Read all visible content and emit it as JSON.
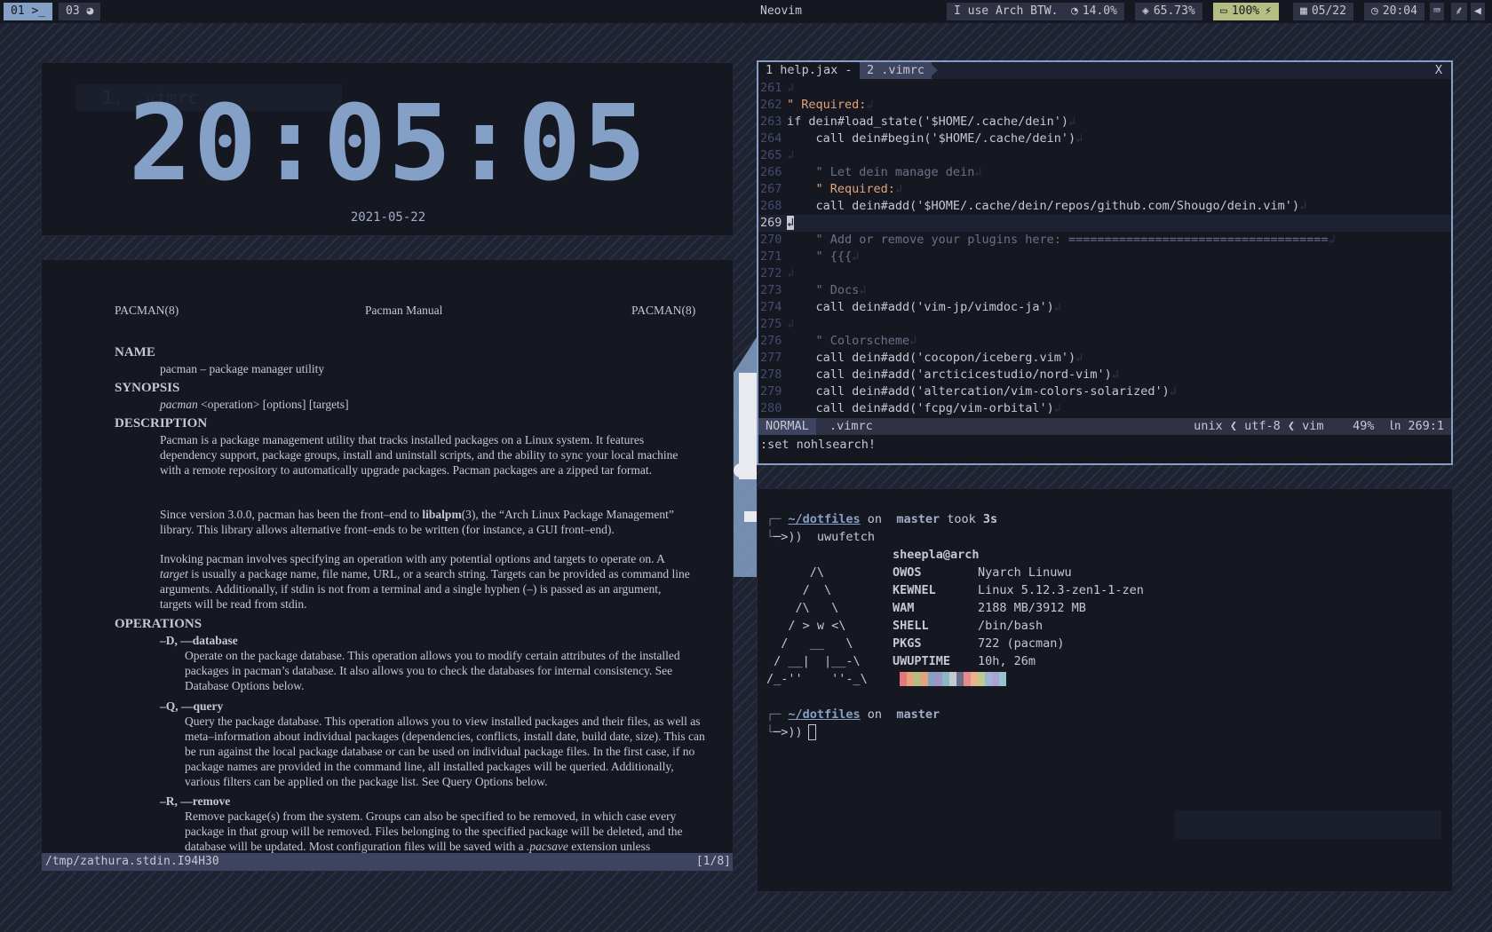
{
  "topbar": {
    "ws1": "01 >_",
    "ws3": "03 ◕",
    "title": "Neovim",
    "arch": "I use Arch BTW.",
    "cpu": "14.0%",
    "mem": "65.73%",
    "battery": "100%",
    "date": "05/22",
    "time": "20:04"
  },
  "clock": {
    "ghost": "1. .vimrc",
    "time": "20:05:05",
    "date": "2021-05-22"
  },
  "zathura": {
    "head_left": "PACMAN(8)",
    "head_center": "Pacman Manual",
    "head_right": "PACMAN(8)",
    "name_h": "NAME",
    "name_text": "pacman – package manager utility",
    "synopsis_h": "SYNOPSIS",
    "synopsis_cmd": "pacman",
    "synopsis_text": " <operation> [options] [targets]",
    "desc_h": "DESCRIPTION",
    "desc_p1": "Pacman is a package management utility that tracks installed packages on a Linux system. It features dependency support, package groups, install and uninstall scripts, and the ability to sync your local machine with a remote repository to automatically upgrade packages. Pacman packages are a zipped tar format.",
    "desc_p2a": "Since version 3.0.0, pacman has been the front–end to ",
    "desc_p2b": "libalpm",
    "desc_p2c": "(3), the “Arch Linux Package Management” library. This library allows alternative front–ends to be written (for instance, a GUI front–end).",
    "desc_p3a": "Invoking pacman involves specifying an operation with any potential options and targets to operate on. A ",
    "desc_p3b": "target",
    "desc_p3c": " is usually a package name, file name, URL, or a search string. Targets can be provided as command line arguments. Additionally, if stdin is not from a terminal and a single hyphen (–) is passed as an argument, targets will be read from stdin.",
    "ops_h": "OPERATIONS",
    "op_d": "–D, ––database",
    "op_d_text": "Operate on the package database. This operation allows you to modify certain attributes of the installed packages in pacman’s database. It also allows you to check the databases for internal consistency. See Database Options below.",
    "op_q": "–Q, ––query",
    "op_q_text": "Query the package database. This operation allows you to view installed packages and their files, as well as meta–information about individual packages (dependencies, conflicts, install date, build date, size). This can be run against the local package database or can be used on individual package files. In the first case, if no package names are provided in the command line, all installed packages will be queried. Additionally, various filters can be applied on the package list. See Query Options below.",
    "op_r": "–R, ––remove",
    "op_r_text_a": "Remove package(s) from the system. Groups can also be specified to be removed, in which case every package in that group will be removed. Files belonging to the specified package will be deleted, and the database will be updated. Most configuration files will be saved with a ",
    "op_r_text_b": ".pacsave",
    "op_r_text_c": " extension unless",
    "status_file": "/tmp/zathura.stdin.I94H30",
    "status_pages": "[1/8]"
  },
  "nvim": {
    "tab1": "1 help.jax -",
    "tab2": "2 .vimrc",
    "close": "X",
    "mode": "NORMAL",
    "file": ".vimrc",
    "ff": "unix",
    "enc": "utf-8",
    "ft": "vim",
    "pct": "49%",
    "ln_sym": "㏑",
    "pos": "269:1",
    "cmd": ":set nohlsearch!",
    "lines": [
      {
        "n": "261",
        "t": ""
      },
      {
        "n": "262",
        "t": "\" Required:"
      },
      {
        "n": "263",
        "t": "if dein#load_state('$HOME/.cache/dein')"
      },
      {
        "n": "264",
        "t": "    call dein#begin('$HOME/.cache/dein')"
      },
      {
        "n": "265",
        "t": ""
      },
      {
        "n": "266",
        "t": "    \" Let dein manage dein"
      },
      {
        "n": "267",
        "t": "    \" Required:"
      },
      {
        "n": "268",
        "t": "    call dein#add('$HOME/.cache/dein/repos/github.com/Shougo/dein.vim')"
      },
      {
        "n": "269",
        "t": ""
      },
      {
        "n": "270",
        "t": "    \" Add or remove your plugins here: ===================================="
      },
      {
        "n": "271",
        "t": "    \" {{{"
      },
      {
        "n": "272",
        "t": ""
      },
      {
        "n": "273",
        "t": "    \" Docs"
      },
      {
        "n": "274",
        "t": "    call dein#add('vim-jp/vimdoc-ja')"
      },
      {
        "n": "275",
        "t": ""
      },
      {
        "n": "276",
        "t": "    \" Colorscheme"
      },
      {
        "n": "277",
        "t": "    call dein#add('cocopon/iceberg.vim')"
      },
      {
        "n": "278",
        "t": "    call dein#add('arcticicestudio/nord-vim')"
      },
      {
        "n": "279",
        "t": "    call dein#add('altercation/vim-colors-solarized')"
      },
      {
        "n": "280",
        "t": "    call dein#add('fcpg/vim-orbital')"
      }
    ]
  },
  "terminal": {
    "p1_path": "~/dotfiles",
    "p1_on": " on ",
    "p1_branch_icon": "",
    "p1_branch": "master",
    "p1_took": " took ",
    "p1_time": "3s",
    "p1_cmd": "uwufetch",
    "prompt_glyph": "─>))",
    "user_host": "sheepla@arch",
    "fetch": [
      {
        "k": "OWOS",
        "v": "Nyarch Linuwu"
      },
      {
        "k": "KEWNEL",
        "v": "Linux 5.12.3-zen1-1-zen"
      },
      {
        "k": "WAM",
        "v": "2188 MB/3912 MB"
      },
      {
        "k": "SHELL",
        "v": "/bin/bash"
      },
      {
        "k": "PKGS",
        "v": "722 (pacman)"
      },
      {
        "k": "UWUPTIME",
        "v": "10h, 26m"
      }
    ],
    "art": [
      "      /\\",
      "     /  \\",
      "    /\\   \\",
      "   / > w <\\",
      "  /   __   \\",
      " / __|  |__-\\",
      "/_-''    ''-_\\"
    ],
    "swatch_colors": [
      "#161821",
      "#e27878",
      "#e2a478",
      "#b4be82",
      "#e2a478",
      "#84a0c6",
      "#a093c7",
      "#89b8c2",
      "#c6c8d1",
      "#6b7089",
      "#e98989",
      "#ebb389",
      "#c0ca8e",
      "#9fb3d6",
      "#ada0d3",
      "#95c4ce"
    ],
    "p2_path": "~/dotfiles",
    "p2_on": " on ",
    "p2_branch_icon": "",
    "p2_branch": "master"
  },
  "colors": {
    "accent": "#84a0c6",
    "bg": "#161821",
    "fg": "#c6c8d1",
    "battery_bg": "#b4be82"
  }
}
